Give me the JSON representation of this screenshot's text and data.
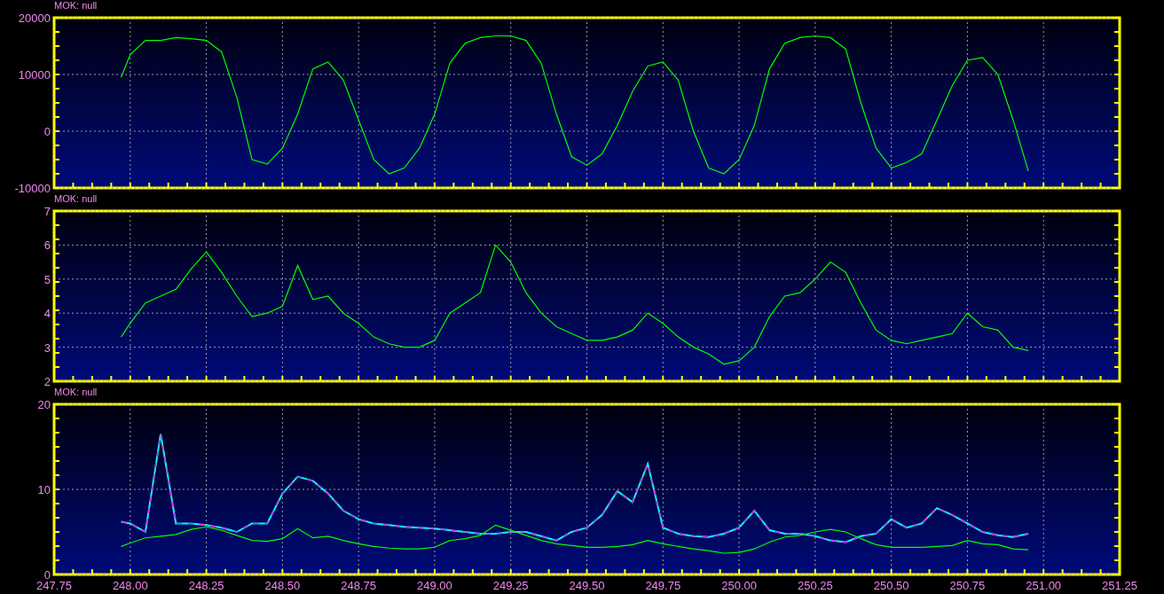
{
  "panels": [
    {
      "title": "MOK: null",
      "chart_data": {
        "type": "line",
        "grid": true,
        "xlim": [
          247.75,
          251.25
        ],
        "ylim": [
          -10000,
          20000
        ],
        "yticks": [
          -10000,
          0,
          10000,
          20000
        ],
        "x": [
          247.97,
          248.0,
          248.05,
          248.1,
          248.15,
          248.2,
          248.25,
          248.3,
          248.35,
          248.4,
          248.45,
          248.5,
          248.55,
          248.6,
          248.65,
          248.7,
          248.75,
          248.8,
          248.85,
          248.9,
          248.95,
          249.0,
          249.05,
          249.1,
          249.15,
          249.2,
          249.25,
          249.3,
          249.35,
          249.4,
          249.45,
          249.5,
          249.55,
          249.6,
          249.65,
          249.7,
          249.75,
          249.8,
          249.85,
          249.9,
          249.95,
          250.0,
          250.05,
          250.1,
          250.15,
          250.2,
          250.25,
          250.3,
          250.35,
          250.4,
          250.45,
          250.5,
          250.55,
          250.6,
          250.65,
          250.7,
          250.75,
          250.8,
          250.85,
          250.9,
          250.95
        ],
        "series": [
          {
            "color": "#00ff00",
            "line_style": "solid",
            "values": [
              9500,
              13500,
              16000,
              16000,
              16500,
              16300,
              16000,
              14000,
              6000,
              -5000,
              -5800,
              -3000,
              3000,
              11000,
              12200,
              9000,
              2000,
              -5000,
              -7500,
              -6500,
              -3000,
              3000,
              12000,
              15500,
              16500,
              16800,
              16800,
              16000,
              12000,
              3000,
              -4500,
              -6000,
              -4000,
              1000,
              7000,
              11500,
              12200,
              9000,
              0,
              -6500,
              -7500,
              -5000,
              1000,
              11000,
              15500,
              16500,
              16800,
              16500,
              14500,
              5000,
              -3000,
              -6500,
              -5500,
              -4000,
              2000,
              8000,
              12500,
              13000,
              10000,
              2000,
              -7000
            ]
          }
        ]
      }
    },
    {
      "title": "MOK: null",
      "chart_data": {
        "type": "line",
        "grid": true,
        "xlim": [
          247.75,
          251.25
        ],
        "ylim": [
          2,
          7
        ],
        "yticks": [
          2,
          3,
          4,
          5,
          6,
          7
        ],
        "x": [
          247.97,
          248.0,
          248.05,
          248.1,
          248.15,
          248.2,
          248.25,
          248.3,
          248.35,
          248.4,
          248.45,
          248.5,
          248.55,
          248.6,
          248.65,
          248.7,
          248.75,
          248.8,
          248.85,
          248.9,
          248.95,
          249.0,
          249.05,
          249.1,
          249.15,
          249.2,
          249.25,
          249.3,
          249.35,
          249.4,
          249.45,
          249.5,
          249.55,
          249.6,
          249.65,
          249.7,
          249.75,
          249.8,
          249.85,
          249.9,
          249.95,
          250.0,
          250.05,
          250.1,
          250.15,
          250.2,
          250.25,
          250.3,
          250.35,
          250.4,
          250.45,
          250.5,
          250.55,
          250.6,
          250.65,
          250.7,
          250.75,
          250.8,
          250.85,
          250.9,
          250.95
        ],
        "series": [
          {
            "color": "#00ff00",
            "line_style": "solid",
            "values": [
              3.3,
              3.7,
              4.3,
              4.5,
              4.7,
              5.3,
              5.8,
              5.2,
              4.5,
              3.9,
              4.0,
              4.2,
              5.4,
              4.4,
              4.5,
              4.0,
              3.7,
              3.3,
              3.1,
              3.0,
              3.0,
              3.2,
              4.0,
              4.3,
              4.6,
              6.0,
              5.5,
              4.6,
              4.0,
              3.6,
              3.4,
              3.2,
              3.2,
              3.3,
              3.5,
              4.0,
              3.7,
              3.3,
              3.0,
              2.8,
              2.5,
              2.6,
              3.0,
              3.9,
              4.5,
              4.6,
              5.0,
              5.5,
              5.2,
              4.3,
              3.5,
              3.2,
              3.1,
              3.2,
              3.3,
              3.4,
              4.0,
              3.6,
              3.5,
              3.0,
              2.9
            ]
          }
        ]
      }
    },
    {
      "title": "MOK: null",
      "chart_data": {
        "type": "line",
        "grid": true,
        "xlim": [
          247.75,
          251.25
        ],
        "ylim": [
          0,
          20
        ],
        "yticks": [
          0,
          10,
          20
        ],
        "xticks": [
          {
            "value": 247.75,
            "label": "247.75"
          },
          {
            "value": 248,
            "label": "248.00"
          },
          {
            "value": 248.25,
            "label": "248.25"
          },
          {
            "value": 248.5,
            "label": "248.50"
          },
          {
            "value": 248.75,
            "label": "248.75"
          },
          {
            "value": 249,
            "label": "249.00"
          },
          {
            "value": 249.25,
            "label": "249.25"
          },
          {
            "value": 249.5,
            "label": "249.50"
          },
          {
            "value": 249.75,
            "label": "249.75"
          },
          {
            "value": 250,
            "label": "250.00"
          },
          {
            "value": 250.25,
            "label": "250.25"
          },
          {
            "value": 250.5,
            "label": "250.50"
          },
          {
            "value": 250.75,
            "label": "250.75"
          },
          {
            "value": 251,
            "label": "251.00"
          },
          {
            "value": 251.25,
            "label": "251.25"
          }
        ],
        "x": [
          247.97,
          248.0,
          248.05,
          248.1,
          248.15,
          248.2,
          248.25,
          248.3,
          248.35,
          248.4,
          248.45,
          248.5,
          248.55,
          248.6,
          248.65,
          248.7,
          248.75,
          248.8,
          248.85,
          248.9,
          248.95,
          249.0,
          249.05,
          249.1,
          249.15,
          249.2,
          249.25,
          249.3,
          249.35,
          249.4,
          249.45,
          249.5,
          249.55,
          249.6,
          249.65,
          249.7,
          249.75,
          249.8,
          249.85,
          249.9,
          249.95,
          250.0,
          250.05,
          250.1,
          250.15,
          250.2,
          250.25,
          250.3,
          250.35,
          250.4,
          250.45,
          250.5,
          250.55,
          250.6,
          250.65,
          250.7,
          250.75,
          250.8,
          250.85,
          250.9,
          250.95
        ],
        "series": [
          {
            "color": "#ff00ff",
            "line_style": "dashed",
            "values": [
              6.2,
              6.0,
              5.0,
              16.5,
              6.0,
              6.0,
              5.8,
              5.5,
              5.0,
              6.0,
              6.0,
              9.5,
              11.5,
              11.0,
              9.5,
              7.5,
              6.5,
              6.0,
              5.8,
              5.6,
              5.5,
              5.4,
              5.2,
              5.0,
              4.8,
              4.8,
              5.0,
              5.0,
              4.5,
              4.0,
              5.0,
              5.5,
              7.0,
              9.8,
              8.5,
              13.0,
              5.5,
              4.8,
              4.5,
              4.4,
              4.8,
              5.5,
              7.5,
              5.2,
              4.8,
              4.8,
              4.5,
              4.0,
              3.8,
              4.5,
              4.8,
              6.5,
              5.5,
              6.0,
              7.8,
              7.0,
              6.0,
              5.0,
              4.6,
              4.4,
              4.8
            ]
          },
          {
            "color": "#00ffff",
            "line_style": "solid",
            "values": [
              6.2,
              6.0,
              5.0,
              16.5,
              6.0,
              6.0,
              5.8,
              5.5,
              5.0,
              6.0,
              6.0,
              9.5,
              11.5,
              11.0,
              9.5,
              7.5,
              6.5,
              6.0,
              5.8,
              5.6,
              5.5,
              5.4,
              5.2,
              5.0,
              4.8,
              4.8,
              5.0,
              5.0,
              4.5,
              4.0,
              5.0,
              5.5,
              7.0,
              9.8,
              8.5,
              13.0,
              5.5,
              4.8,
              4.5,
              4.4,
              4.8,
              5.5,
              7.5,
              5.2,
              4.8,
              4.8,
              4.5,
              4.0,
              3.8,
              4.5,
              4.8,
              6.5,
              5.5,
              6.0,
              7.8,
              7.0,
              6.0,
              5.0,
              4.6,
              4.4,
              4.8
            ]
          },
          {
            "color": "#00ff00",
            "line_style": "solid",
            "values": [
              3.3,
              3.7,
              4.3,
              4.5,
              4.7,
              5.3,
              5.6,
              5.2,
              4.6,
              4.0,
              3.9,
              4.2,
              5.4,
              4.3,
              4.5,
              4.0,
              3.6,
              3.3,
              3.1,
              3.0,
              3.0,
              3.2,
              4.0,
              4.2,
              4.6,
              5.8,
              5.2,
              4.6,
              4.0,
              3.6,
              3.4,
              3.2,
              3.2,
              3.3,
              3.5,
              4.0,
              3.6,
              3.3,
              3.0,
              2.8,
              2.5,
              2.6,
              3.0,
              3.8,
              4.4,
              4.6,
              5.0,
              5.3,
              5.0,
              4.2,
              3.5,
              3.2,
              3.2,
              3.2,
              3.3,
              3.4,
              4.0,
              3.6,
              3.5,
              3.0,
              2.9
            ]
          }
        ]
      }
    }
  ]
}
